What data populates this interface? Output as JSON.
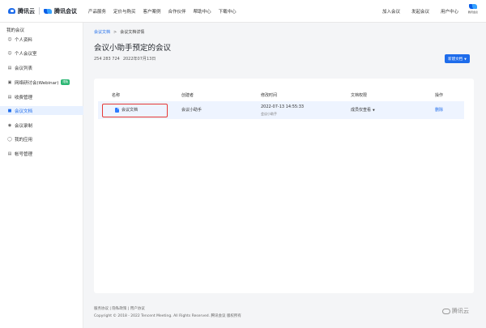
{
  "header": {
    "brand1": "腾讯云",
    "brand2": "腾讯会议",
    "nav": [
      "产品服务",
      "定价与购买",
      "客户案例",
      "合作伙伴",
      "帮助中心",
      "下载中心"
    ],
    "right_nav": [
      "加入会议",
      "发起会议",
      "用户中心"
    ],
    "right_logo_text": "腾讯会议"
  },
  "sidebar": {
    "title": "我的会议",
    "items": [
      {
        "label": "个人资料"
      },
      {
        "label": "个人会议室"
      },
      {
        "label": "会议列表"
      },
      {
        "label": "网络研讨会(Webinar)",
        "badge": "限免"
      },
      {
        "label": "收费管理"
      },
      {
        "label": "会议文档"
      },
      {
        "label": "会议录制"
      },
      {
        "label": "我的应用"
      },
      {
        "label": "帐号管理"
      }
    ]
  },
  "breadcrumb": {
    "link": "会议文档",
    "sep": ">",
    "current": "会议文档详情"
  },
  "page": {
    "title": "会议小助手预定的会议",
    "meeting_id": "254 283 724",
    "date": "2022年07月13日",
    "new_doc_label": "新建文档"
  },
  "table": {
    "headers": [
      "名称",
      "创建者",
      "修改时间",
      "文档权限",
      "操作"
    ],
    "rows": [
      {
        "name": "会议文档",
        "creator": "会议小助手",
        "modified": "2022-07-13 14:55:33",
        "modified_by": "会议小助手",
        "permission": "成员仅查看",
        "action": "删除"
      }
    ]
  },
  "footer": {
    "links": "服务协议 | 隐私政策 | 用户协议",
    "copyright": "Copyright © 2018 - 2022 Tencent Meeting. All Rights Reserved. 腾讯会议 版权所有",
    "brand": "腾讯云"
  },
  "colors": {
    "accent": "#1e6ceb",
    "highlight_border": "#e53935",
    "badge": "#2bb673"
  }
}
